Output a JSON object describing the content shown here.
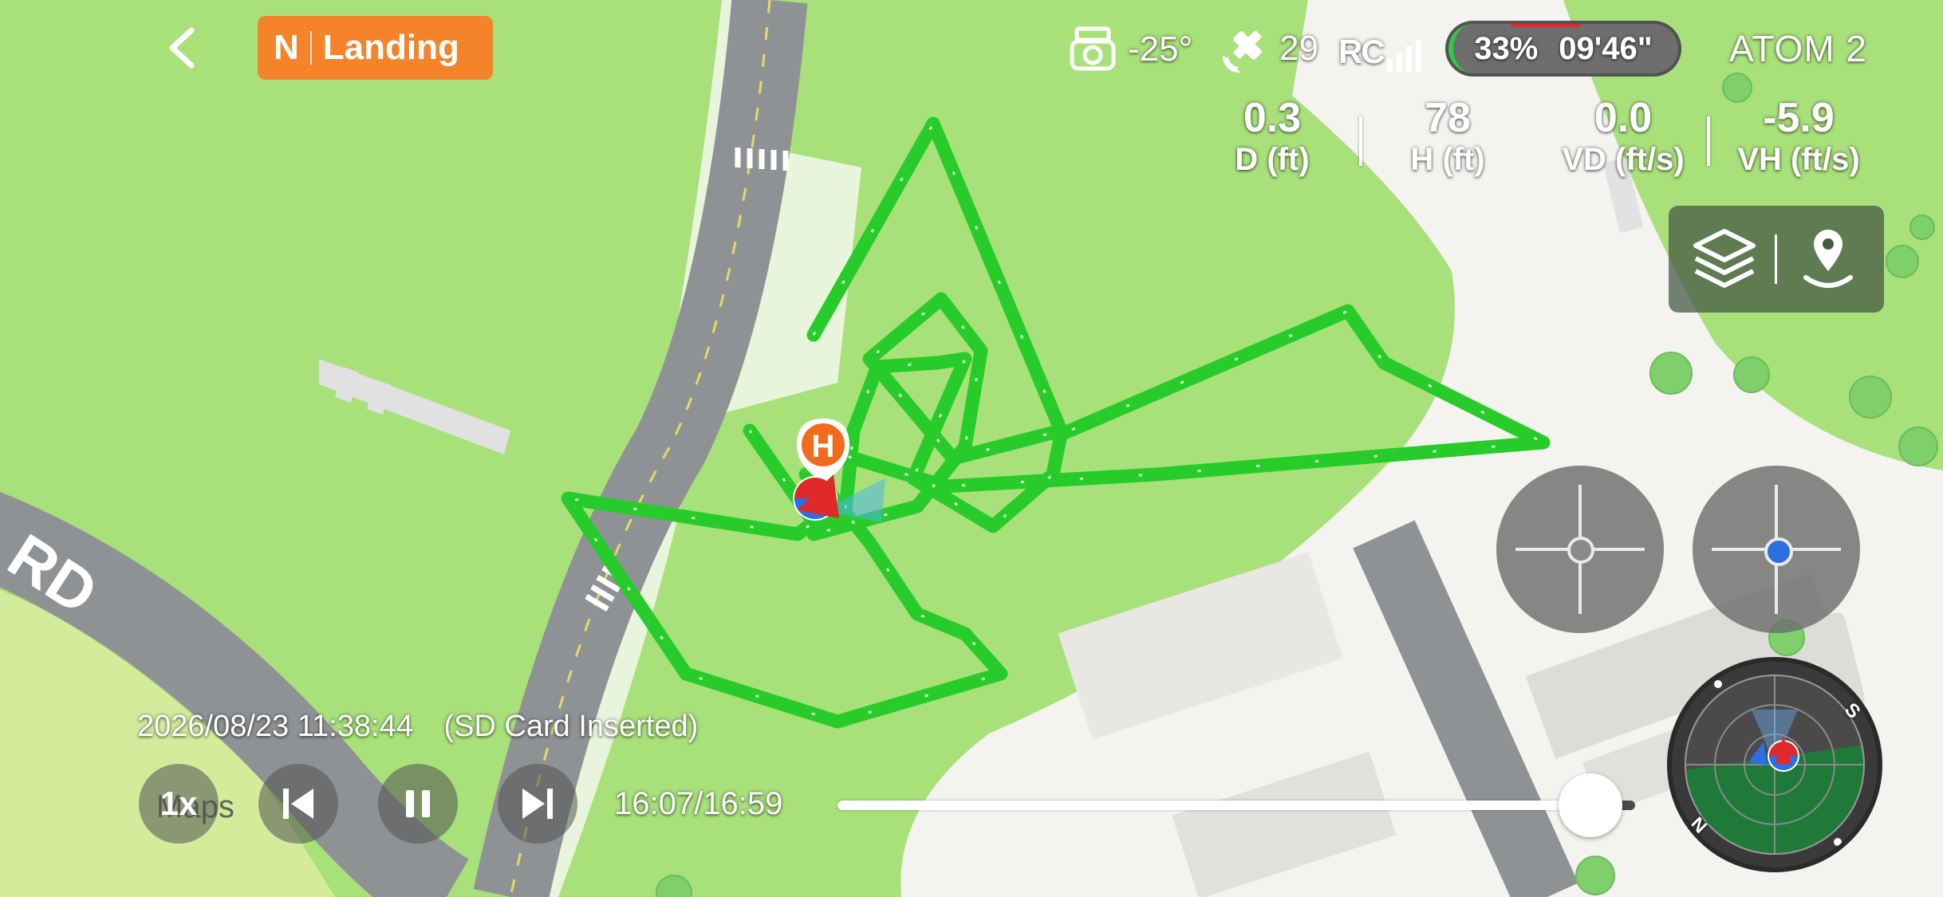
{
  "header": {
    "mode_letter": "N",
    "mode_label": "Landing",
    "camera_tilt": "-25°",
    "satellites": "29",
    "rc_label": "RC",
    "battery": "33%",
    "flight_time": "09'46\"",
    "drone_name": "ATOM 2"
  },
  "telemetry": [
    {
      "value": "0.3",
      "label": "D (ft)"
    },
    {
      "value": "78",
      "label": "H (ft)"
    },
    {
      "value": "0.0",
      "label": "VD (ft/s)"
    },
    {
      "value": "-5.9",
      "label": "VH (ft/s)"
    }
  ],
  "map": {
    "street_fragment": "RD",
    "attribution": "Maps",
    "home_marker": "H",
    "compass_n": "N",
    "compass_s": "S"
  },
  "playback": {
    "timestamp": "2026/08/23 11:38:44",
    "sd_status": "(SD Card Inserted)",
    "speed": "1x",
    "position": "16:07/16:59",
    "progress_fraction": 0.944
  },
  "colors": {
    "mode_badge": "#f5832a",
    "track": "#27cc2a",
    "grass": "#a8e07a",
    "road": "#8f9294"
  }
}
